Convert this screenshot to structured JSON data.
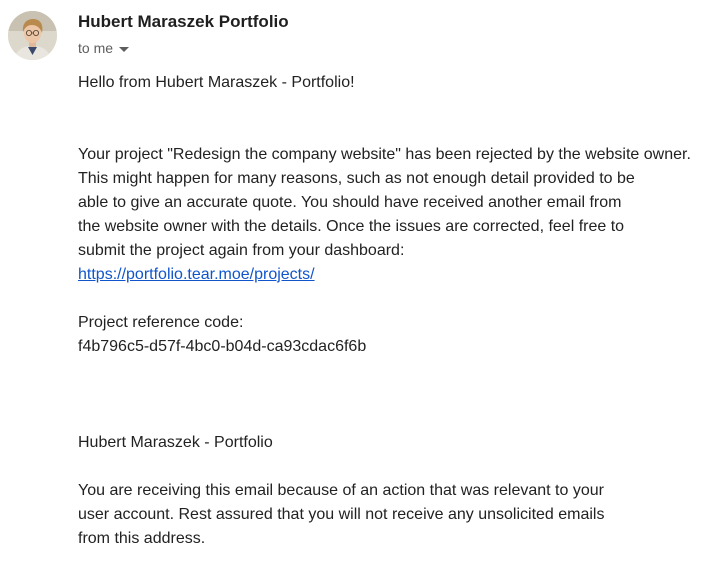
{
  "sender": {
    "name": "Hubert Maraszek Portfolio",
    "recipient_label": "to me"
  },
  "message": {
    "greeting": "Hello from Hubert Maraszek - Portfolio!",
    "body_lines": [
      "Your project \"Redesign the company website\" has been rejected by the website owner.",
      "This might happen for many reasons, such as not enough detail provided to be",
      "able to give an accurate quote. You should have received another email from",
      "the website owner with the details. Once the issues are corrected, feel free to",
      "submit the project again from your dashboard:"
    ],
    "dashboard_link": "https://portfolio.tear.moe/projects/",
    "reference_label": "Project reference code:",
    "reference_code": "f4b796c5-d57f-4bc0-b04d-ca93cdac6f6b",
    "signature": "Hubert Maraszek - Portfolio",
    "footer_lines": [
      "You are receiving this email because of an action that was relevant to your",
      "user account. Rest assured that you will not receive any unsolicited emails",
      "from this address."
    ]
  },
  "colors": {
    "link": "#1155cc",
    "text": "#222222",
    "muted": "#5e5e5e"
  }
}
